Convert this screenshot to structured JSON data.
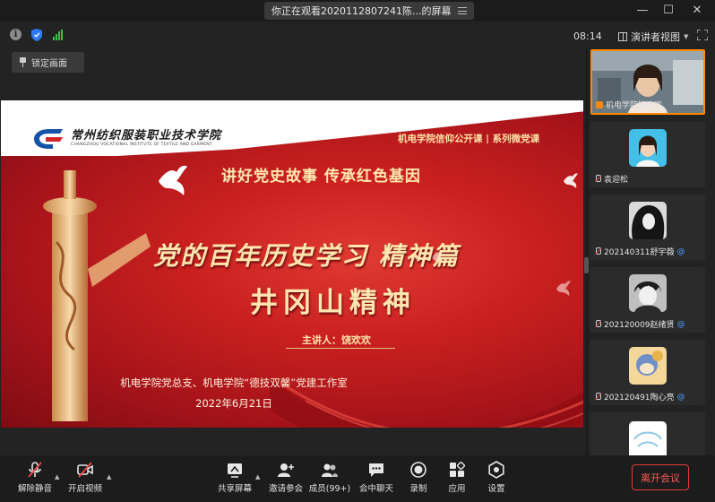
{
  "window": {
    "title": "你正在观看2020112807241陈...的屏幕",
    "controls": {
      "minimize": "—",
      "maximize": "☐",
      "close": "✕"
    }
  },
  "infobar": {
    "time": "08:14",
    "view_mode": "演讲者视图"
  },
  "lock_button": {
    "label": "锁定画面"
  },
  "slide": {
    "school_cn": "常州纺织服装职业技术学院",
    "school_en": "CHANGZHOU VOCATIONAL INSTITUTE OF TEXTILE AND GARMENT",
    "course_tag": "机电学院信仰公开课 | 系列微党课",
    "subtitle": "讲好党史故事 传承红色基因",
    "title_line1": "党的百年历史学习 精神篇",
    "title_line2": "井冈山精神",
    "speaker": "主讲人：饶欢欢",
    "organizer": "机电学院党总支、机电学院“德技双馨”党建工作室",
    "date": "2022年6月21日"
  },
  "participants": [
    {
      "name": "机电学院饶欢欢",
      "active": true,
      "has_at": false
    },
    {
      "name": "袁迎松",
      "active": false,
      "has_at": false
    },
    {
      "name": "202140311舒宇薇",
      "active": false,
      "has_at": true
    },
    {
      "name": "202120009赵绪贤",
      "active": false,
      "has_at": true
    },
    {
      "name": "202120491陶心亮",
      "active": false,
      "has_at": true
    },
    {
      "name": "",
      "active": false,
      "has_at": false
    }
  ],
  "toolbar": {
    "mute": "解除静音",
    "video": "开启视频",
    "share": "共享屏幕",
    "invite": "邀请参会",
    "members": "成员(99+)",
    "chat": "会中聊天",
    "record": "录制",
    "apps": "应用",
    "settings": "设置",
    "leave": "离开会议"
  },
  "colors": {
    "accent_orange": "#ff8a00",
    "leave_red": "#e23c3c",
    "signal_green": "#3ec152",
    "shield_blue": "#2f7bff",
    "slide_red": "#c9201f"
  }
}
